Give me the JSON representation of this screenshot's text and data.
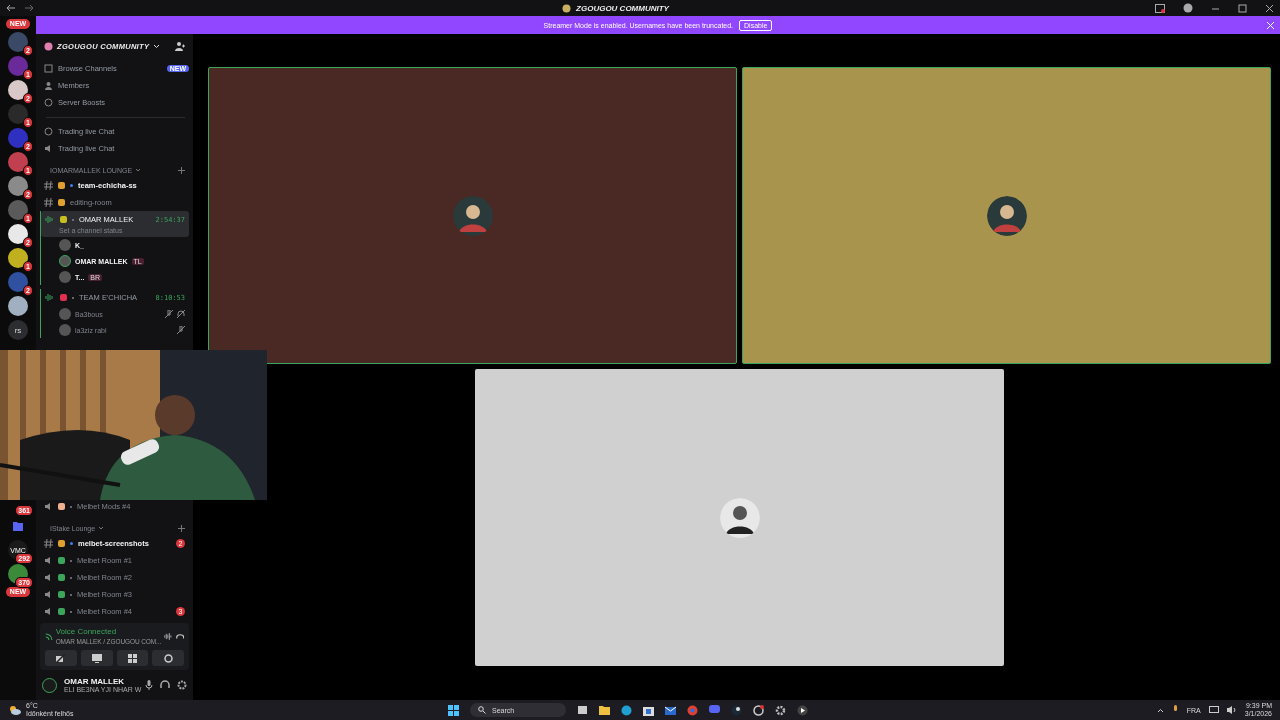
{
  "window": {
    "title": "ZGOUGOU COMMUNITY"
  },
  "banner": {
    "text": "Streamer Mode is enabled. Usernames have been truncated.",
    "button": "Disable"
  },
  "rail_top_badge": "NEW",
  "servers": [
    {
      "kind": "avatar",
      "color": "#3a4a66",
      "badge": "2"
    },
    {
      "kind": "avatar",
      "color": "#6a2a9a",
      "badge": "1"
    },
    {
      "kind": "avatar",
      "color": "#d8c8c8",
      "badge": "2"
    },
    {
      "kind": "avatar",
      "color": "#2a2a2a",
      "badge": "1"
    },
    {
      "kind": "avatar",
      "color": "#3030c0",
      "badge": "2"
    },
    {
      "kind": "avatar",
      "color": "#c04050",
      "badge": "1"
    },
    {
      "kind": "avatar",
      "color": "#8a8a8a",
      "badge": "2"
    },
    {
      "kind": "avatar",
      "color": "#5a5a5a",
      "badge": "1"
    },
    {
      "kind": "avatar",
      "color": "#e8e8e8",
      "badge": "2"
    },
    {
      "kind": "avatar",
      "color": "#c0b020",
      "badge": "1"
    },
    {
      "kind": "avatar",
      "color": "#3050a0",
      "badge": "2"
    },
    {
      "kind": "avatar",
      "color": "#a0b0c0"
    },
    {
      "kind": "text",
      "label": "rs"
    }
  ],
  "servers_lower": [
    {
      "kind": "covered",
      "badge": "361"
    },
    {
      "kind": "folder",
      "color": "#5865f2"
    },
    {
      "kind": "text",
      "label": "VMC",
      "badge": "292"
    },
    {
      "kind": "avatar",
      "color": "#3a8a3a",
      "badge": "370"
    }
  ],
  "rail_bottom_badge": "NEW",
  "server": {
    "name": "ZGOUGOU COMMUNITY"
  },
  "channels": [
    {
      "kind": "nav",
      "name": "Browse Channels",
      "badge": "NEW"
    },
    {
      "kind": "nav",
      "name": "Members"
    },
    {
      "kind": "nav",
      "name": "Server Boosts"
    },
    {
      "kind": "divider"
    },
    {
      "kind": "nav",
      "name": "Trading live Chat"
    },
    {
      "kind": "nav",
      "name": "Trading live Chat"
    },
    {
      "kind": "category",
      "name": "IOMARMALLEK LOUNGE"
    },
    {
      "kind": "text",
      "name": "team-echicha-ss",
      "unread": true,
      "color": "#e0a030"
    },
    {
      "kind": "text",
      "name": "editing-room",
      "unread": false,
      "color": "#e0a030"
    },
    {
      "kind": "voice",
      "name": "OMAR MALLEK",
      "color": "#c8c020",
      "timer": "2:54:37",
      "status": "Set a channel status",
      "selected": true,
      "children": [
        {
          "name": "K_",
          "speaking": false
        },
        {
          "name": "OMAR MALLEK",
          "tag": "TL",
          "speaking": true
        },
        {
          "name": "T...",
          "tag": "BR",
          "speaking": false
        }
      ]
    },
    {
      "kind": "voice",
      "name": "TEAM E'CHICHA",
      "color": "#e03050",
      "timer": "8:10:53",
      "selected": false,
      "children": [
        {
          "name": "Ba3bous",
          "muted": true,
          "deafened": true
        },
        {
          "name": "la3ziz rabi",
          "muted": true,
          "deafened": false
        }
      ]
    },
    {
      "kind": "hidden"
    },
    {
      "kind": "voicechan",
      "name": "Melbet Mods #4",
      "color": "#f0b090"
    },
    {
      "kind": "category",
      "name": "IStake Lounge"
    },
    {
      "kind": "text",
      "name": "melbet-screenshots",
      "unread": true,
      "color": "#e0a030",
      "mentions": "2"
    },
    {
      "kind": "voicechan",
      "name": "Melbet Room #1",
      "color": "#3ba55c"
    },
    {
      "kind": "voicechan",
      "name": "Melbet Room #2",
      "color": "#3ba55c"
    },
    {
      "kind": "voicechan",
      "name": "Melbet Room #3",
      "color": "#3ba55c"
    },
    {
      "kind": "voicechan",
      "name": "Melbet Room #4",
      "color": "#3ba55c",
      "mentions": "3"
    }
  ],
  "voice_panel": {
    "status": "Voice Connected",
    "channel": "OMAR MALLEK / ZGOUGOU COM..."
  },
  "user": {
    "name": "OMAR MALLEK",
    "status": "ELI BE3NA YJI NHAR W"
  },
  "tiles": [
    {
      "kind": "picture",
      "color": "#4a2824",
      "speaking": true
    },
    {
      "kind": "picture",
      "color": "#a8944c",
      "speaking": true
    },
    {
      "kind": "picture",
      "color": "#d0d0d0",
      "speaking": false
    }
  ],
  "webcam": {
    "kind": "picture"
  },
  "taskbar": {
    "temperature": "6°C",
    "weather": "Időnként felhős",
    "search": "Search",
    "language": "FRA",
    "time": "9:39 PM",
    "date": "3/1/2026"
  }
}
